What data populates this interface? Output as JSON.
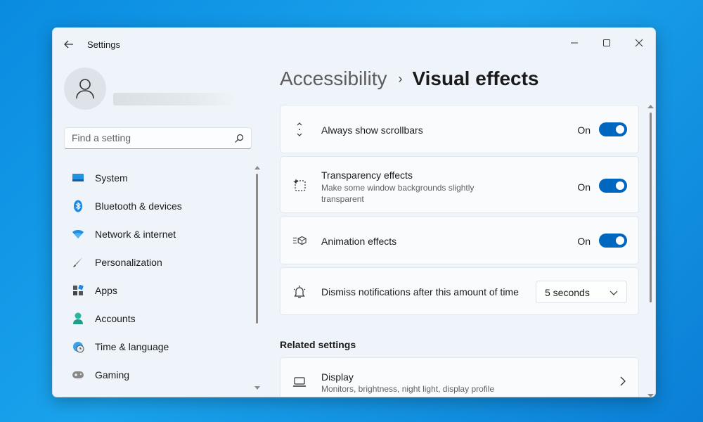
{
  "window": {
    "title": "Settings"
  },
  "colors": {
    "accent": "#0067c0",
    "text": "#1b1b1b",
    "subtext": "#616161"
  },
  "search": {
    "placeholder": "Find a setting"
  },
  "sidebar": {
    "items": [
      {
        "label": "System",
        "icon": "system-icon"
      },
      {
        "label": "Bluetooth & devices",
        "icon": "bluetooth-icon"
      },
      {
        "label": "Network & internet",
        "icon": "wifi-icon"
      },
      {
        "label": "Personalization",
        "icon": "brush-icon"
      },
      {
        "label": "Apps",
        "icon": "apps-icon"
      },
      {
        "label": "Accounts",
        "icon": "person-icon"
      },
      {
        "label": "Time & language",
        "icon": "globe-clock-icon"
      },
      {
        "label": "Gaming",
        "icon": "gamepad-icon"
      }
    ]
  },
  "breadcrumb": {
    "parent": "Accessibility",
    "separator": "›",
    "current": "Visual effects"
  },
  "settings": {
    "scrollbars": {
      "title": "Always show scrollbars",
      "state": "On"
    },
    "transparency": {
      "title": "Transparency effects",
      "description": "Make some window backgrounds slightly transparent",
      "state": "On"
    },
    "animation": {
      "title": "Animation effects",
      "state": "On"
    },
    "notifications": {
      "title": "Dismiss notifications after this amount of time",
      "value": "5 seconds"
    }
  },
  "related": {
    "heading": "Related settings",
    "display": {
      "title": "Display",
      "description": "Monitors, brightness, night light, display profile"
    }
  }
}
